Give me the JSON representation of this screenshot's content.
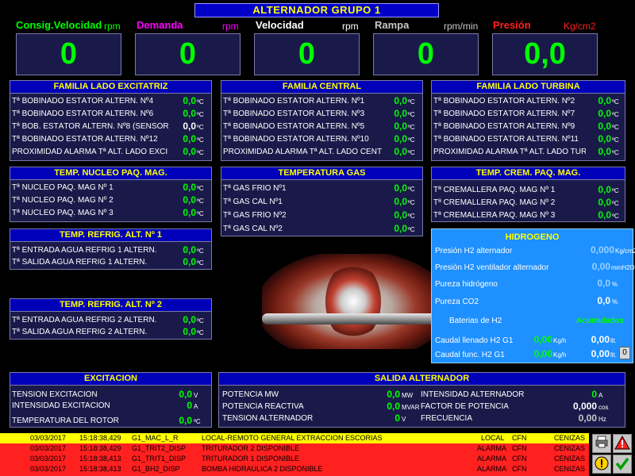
{
  "header": {
    "title": "ALTERNADOR GRUPO 1"
  },
  "top_displays": [
    {
      "label": "Consig.Velocidad",
      "unit": "rpm",
      "value": "0",
      "label_color": "#00ff00",
      "unit_color": "#00ff00"
    },
    {
      "label": "Demanda",
      "unit": "rpm",
      "value": "0",
      "label_color": "#ff00ff",
      "unit_color": "#ff00ff"
    },
    {
      "label": "Velocidad",
      "unit": "rpm",
      "value": "0",
      "label_color": "#ffffff",
      "unit_color": "#ffffff"
    },
    {
      "label": "Rampa",
      "unit": "rpm/min",
      "value": "0",
      "label_color": "#c8c8c8",
      "unit_color": "#c8c8c8"
    },
    {
      "label": "Presión",
      "unit": "Kg/cm2",
      "value": "0,0",
      "label_color": "#ff2020",
      "unit_color": "#ff2020"
    }
  ],
  "panels": {
    "excitatriz": {
      "title": "FAMILIA LADO EXCITATRIZ",
      "rows": [
        {
          "label": "Tª BOBINADO ESTÁTOR ALTERN. Nº4",
          "value": "0,0",
          "unit": "ºC"
        },
        {
          "label": "Tª BOBINADO ESTÁTOR ALTERN. Nº6",
          "value": "0,0",
          "unit": "ºC"
        },
        {
          "label": "Tª BOB. ESTÁTOR ALTERN. Nº8 (SENSOR",
          "value": "0,0",
          "unit": "ºC"
        },
        {
          "label": "Tª BOBINADO ESTÁTOR ALTERN. Nº12",
          "value": "0,0",
          "unit": "ºC"
        },
        {
          "label": "PROXIMIDAD ALARMA Tª ALT. LADO EXCI",
          "value": "0,0",
          "unit": "ºC"
        }
      ]
    },
    "central": {
      "title": "FAMILIA CENTRAL",
      "rows": [
        {
          "label": "Tª BOBINADO ESTÁTOR ALTERN. Nº1",
          "value": "0,0",
          "unit": "ºC"
        },
        {
          "label": "Tª BOBINADO ESTÁTOR ALTERN. Nº3",
          "value": "0,0",
          "unit": "ºC"
        },
        {
          "label": "Tª BOBINADO ESTÁTOR ALTERN. Nº5",
          "value": "0,0",
          "unit": "ºC"
        },
        {
          "label": "Tª BOBINADO ESTÁTOR ALTERN. Nº10",
          "value": "0,0",
          "unit": "ºC"
        },
        {
          "label": "PROXIMIDAD ALARMA Tª ALT. LADO CENT",
          "value": "0,0",
          "unit": "ºC"
        }
      ]
    },
    "turbina": {
      "title": "FAMILIA LADO TURBINA",
      "rows": [
        {
          "label": "Tª BOBINADO ESTÁTOR ALTERN. Nº2",
          "value": "0,0",
          "unit": "ºC"
        },
        {
          "label": "Tª BOBINADO ESTÁTOR ALTERN. Nº7",
          "value": "0,0",
          "unit": "ºC"
        },
        {
          "label": "Tª BOBINADO ESTÁTOR ALTERN. Nº9",
          "value": "0,0",
          "unit": "ºC"
        },
        {
          "label": "Tª BOBINADO ESTÁTOR ALTERN. Nº11",
          "value": "0,0",
          "unit": "ºC"
        },
        {
          "label": "PROXIMIDAD ALARMA Tª ALT. LADO TURB",
          "value": "0,0",
          "unit": "ºC"
        }
      ]
    },
    "nucleo": {
      "title": "TEMP. NUCLEO PAQ. MAG.",
      "rows": [
        {
          "label": "Tª NUCLEO PAQ. MAG Nº 1",
          "value": "0,0",
          "unit": "ºC"
        },
        {
          "label": "Tª NUCLEO PAQ. MAG Nº 2",
          "value": "0,0",
          "unit": "ºC"
        },
        {
          "label": "Tª NUCLEO PAQ. MAG Nº 3",
          "value": "0,0",
          "unit": "ºC"
        }
      ]
    },
    "gas": {
      "title": "TEMPERATURA GAS",
      "rows": [
        {
          "label": "Tª GAS FRÍO Nº1",
          "value": "0,0",
          "unit": "ºC"
        },
        {
          "label": "Tª GAS CAL Nº1",
          "value": "0,0",
          "unit": "ºC"
        },
        {
          "label": "Tª GAS FRÍO Nº2",
          "value": "0,0",
          "unit": "ºC"
        },
        {
          "label": "Tª GAS CAL Nº2",
          "value": "0,0",
          "unit": "ºC"
        }
      ]
    },
    "cremallera": {
      "title": "TEMP. CREM. PAQ. MAG.",
      "rows": [
        {
          "label": "Tª CREMALLERA PAQ. MAG Nº 1",
          "value": "0,0",
          "unit": "ºC"
        },
        {
          "label": "Tª CREMALLERA PAQ. MAG Nº 2",
          "value": "0,0",
          "unit": "ºC"
        },
        {
          "label": "Tª CREMALLERA PAQ. MAG Nº 3",
          "value": "0,0",
          "unit": "ºC"
        }
      ]
    },
    "refrig1": {
      "title": "TEMP. REFRIG. ALT. Nº 1",
      "rows": [
        {
          "label": "Tª ENTRADA AGUA REFRIG 1 ALTERN.",
          "value": "0,0",
          "unit": "ºC"
        },
        {
          "label": "Tª SALIDA AGUA REFRIG 1 ALTERN.",
          "value": "0,0",
          "unit": "ºC"
        }
      ]
    },
    "refrig2": {
      "title": "TEMP. REFRIG. ALT. Nº 2",
      "rows": [
        {
          "label": "Tª ENTRADA AGUA REFRIG 2 ALTERN.",
          "value": "0,0",
          "unit": "ºC"
        },
        {
          "label": "Tª SALIDA AGUA REFRIG 2 ALTERN.",
          "value": "0,0",
          "unit": "ºC"
        }
      ]
    }
  },
  "hidrogeno": {
    "title": "HIDROGENO",
    "rows": [
      {
        "label": "Presión H2 alternador",
        "value": "0,000",
        "unit": "Kg/cm2"
      },
      {
        "label": "Presión H2 ventilador alternador",
        "value": "0,00",
        "unit": "mmH2O"
      },
      {
        "label": "Pureza hidrógeno",
        "value": "0,0",
        "unit": "%"
      },
      {
        "label": "Pureza CO2",
        "value": "0,0",
        "unit": "%"
      }
    ],
    "baterias_label": "Baterias de H2",
    "acumulados_label": "Acumulados",
    "caudal": [
      {
        "label": "Caudal llenado H2 G1",
        "value": "0,00",
        "unit": "Kg/h",
        "acc_value": "0,00",
        "acc_unit": "lit."
      },
      {
        "label": "Caudal func. H2 G1",
        "value": "0,00",
        "unit": "Kg/h",
        "acc_value": "0,00",
        "acc_unit": "lit."
      }
    ],
    "reset_button": "0"
  },
  "excitacion": {
    "title": "EXCITACION",
    "rows": [
      {
        "label": "TENSIÓN EXCITACIÓN",
        "value": "0,0",
        "unit": "V"
      },
      {
        "label": "INTENSIDAD EXCITACIÓN",
        "value": "0",
        "unit": "A"
      },
      {
        "label": "TEMPERATURA DEL ROTOR",
        "value": "0,0",
        "unit": "ºC"
      }
    ]
  },
  "salida": {
    "title": "SALIDA ALTERNADOR",
    "left": [
      {
        "label": "POTENCIA MW",
        "value": "0,0",
        "unit": "MW"
      },
      {
        "label": "POTENCIA REACTIVA",
        "value": "0,0",
        "unit": "MVAR"
      },
      {
        "label": "TENSIÓN ALTERNADOR",
        "value": "0",
        "unit": "V"
      }
    ],
    "right": [
      {
        "label": "INTENSIDAD ALTERNADOR",
        "value": "0",
        "unit": "A"
      },
      {
        "label": "FACTOR DE POTENCIA",
        "value": "0,000",
        "unit": "cos"
      },
      {
        "label": "FRECUENCIA",
        "value": "0,00",
        "unit": "Hz"
      }
    ]
  },
  "alarms": [
    {
      "date": "03/03/2017",
      "time": "15:18:38,429",
      "tag": "G1_MAC_L_R",
      "desc": "LOCAL-REMOTO GENERAL EXTRACCION ESCORIAS",
      "state": "LOCAL",
      "plant": "CFN",
      "area": "CENIZAS",
      "color": "#ffff00"
    },
    {
      "date": "03/03/2017",
      "time": "15:18:38,429",
      "tag": "G1_TRIT2_DISP",
      "desc": "TRITURADOR 2 DISPONIBLE",
      "state": "ALARMA",
      "plant": "CFN",
      "area": "CENIZAS",
      "color": "#ff2020"
    },
    {
      "date": "03/03/2017",
      "time": "15:18:38,413",
      "tag": "G1_TRIT1_DISP",
      "desc": "TRITURADOR 1 DISPONIBLE",
      "state": "ALARMA",
      "plant": "CFN",
      "area": "CENIZAS",
      "color": "#ff2020"
    },
    {
      "date": "03/03/2017",
      "time": "15:18:38,413",
      "tag": "G1_BH2_DISP",
      "desc": "BOMBA HIDRAULICA 2 DISPONIBLE",
      "state": "ALARMA",
      "plant": "CFN",
      "area": "CENIZAS",
      "color": "#ff2020"
    }
  ]
}
